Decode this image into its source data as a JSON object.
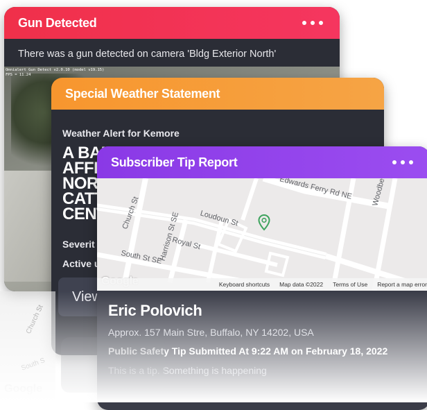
{
  "gun_card": {
    "title": "Gun Detected",
    "description": "There was a gun detected on camera 'Bldg Exterior North'",
    "overlay_line1": "Omnialert Gun Detect v2.0.10 (model v19.15)",
    "overlay_line2": "FPS = 11.24",
    "menu_icon": "more-horizontal-icon",
    "accent": "#f0304a"
  },
  "weather_card": {
    "title": "Special Weather Statement",
    "subtitle": "Weather Alert for Kemore",
    "headline_lines": [
      "A BAN",
      "AFFE",
      "NORT",
      "CATT",
      "CENT"
    ],
    "severity_label": "Severit",
    "active_label": "Active u",
    "view_button_label": "View",
    "accent": "#f7962e"
  },
  "tip_card": {
    "title": "Subscriber Tip Report",
    "menu_icon": "more-horizontal-icon",
    "accent": "#8a39e6",
    "map": {
      "streets": [
        "Edwards Ferry Rd NE",
        "Loudoun St",
        "Church St",
        "Harrison St SE",
        "Royal St",
        "South St SE",
        "Woodbe"
      ],
      "google_logo": "Google",
      "footer": [
        "Keyboard shortcuts",
        "Map data ©2022",
        "Terms of Use",
        "Report a map error"
      ],
      "pin_icon": "map-pin-icon"
    },
    "name": "Eric Polovich",
    "address": "Approx. 157 Main Stre, Buffalo, NY 14202, USA",
    "submitted": "Public Safety Tip Submitted At 9:22 AM on February 18, 2022",
    "body": "This is a tip. Something is happening"
  },
  "reflection": {
    "church": "Church St",
    "south": "South S",
    "google": "Google"
  }
}
